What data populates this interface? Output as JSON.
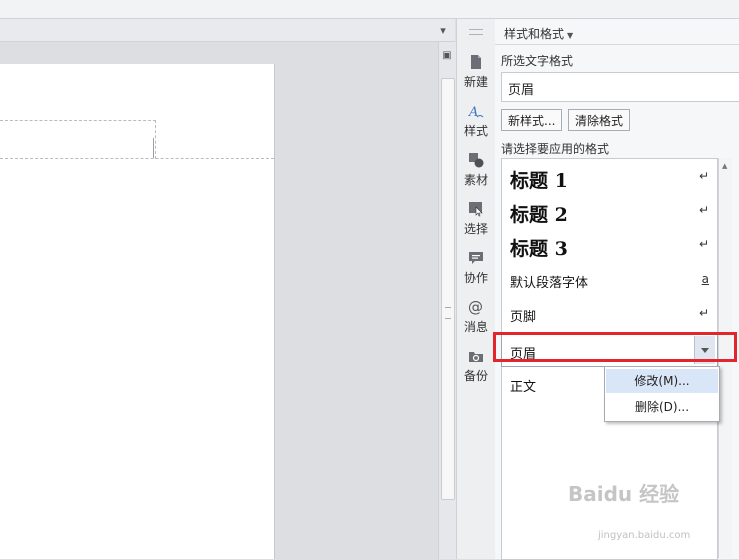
{
  "panel": {
    "title": "样式和格式",
    "current_format_label": "所选文字格式",
    "current_format_value": "页眉",
    "new_style_button": "新样式...",
    "clear_format_button": "清除格式",
    "apply_label": "请选择要应用的格式"
  },
  "tabs": [
    {
      "label": "新建",
      "icon": "new-document-icon"
    },
    {
      "label": "样式",
      "icon": "style-icon"
    },
    {
      "label": "素材",
      "icon": "material-icon"
    },
    {
      "label": "选择",
      "icon": "select-icon"
    },
    {
      "label": "协作",
      "icon": "collaborate-icon"
    },
    {
      "label": "消息",
      "icon": "at-message-icon"
    },
    {
      "label": "备份",
      "icon": "backup-icon"
    }
  ],
  "styles": [
    {
      "label": "标题 1",
      "mark": "↵"
    },
    {
      "label": "标题 2",
      "mark": "↵"
    },
    {
      "label": "标题 3",
      "mark": "↵"
    },
    {
      "label": "默认段落字体",
      "mark": "a"
    },
    {
      "label": "页脚",
      "mark": "↵"
    },
    {
      "label": "页眉",
      "mark": ""
    },
    {
      "label": "正文",
      "mark": ""
    }
  ],
  "context_menu": {
    "modify": "修改(M)...",
    "delete": "删除(D)..."
  },
  "watermark": {
    "brand": "Baidu 经验",
    "url": "jingyan.baidu.com"
  },
  "colors": {
    "highlight_border": "#e3262b",
    "menu_hover": "#d9e6f8"
  }
}
